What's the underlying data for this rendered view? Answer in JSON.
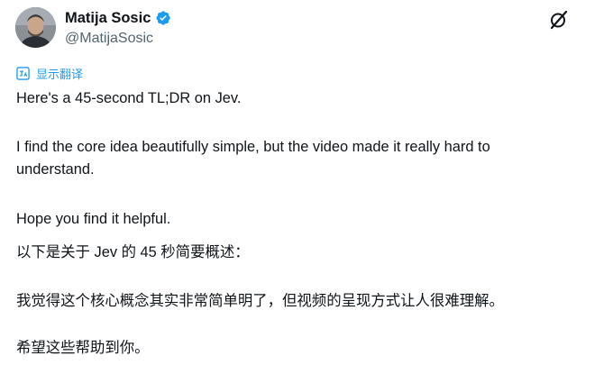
{
  "author": {
    "display_name": "Matija Sosic",
    "handle": "@MatijaSosic",
    "verified_icon": "verified-badge-icon",
    "verified_color": "#1d9bf0"
  },
  "actions": {
    "grok_icon": "grok-icon"
  },
  "translate": {
    "label": "显示翻译",
    "icon": "translate-icon"
  },
  "tweet": {
    "line1": "Here's a 45-second TL;DR on Jev.",
    "line2a": "I find the core idea beautifully simple, but the video made it really hard to",
    "line2b": "understand.",
    "line3": "Hope you find it helpful."
  },
  "translation": {
    "line1": "以下是关于 Jev 的 45 秒简要概述：",
    "line2": "我觉得这个核心概念其实非常简单明了，但视频的呈现方式让人很难理解。",
    "line3": "希望这些帮助到你。"
  }
}
